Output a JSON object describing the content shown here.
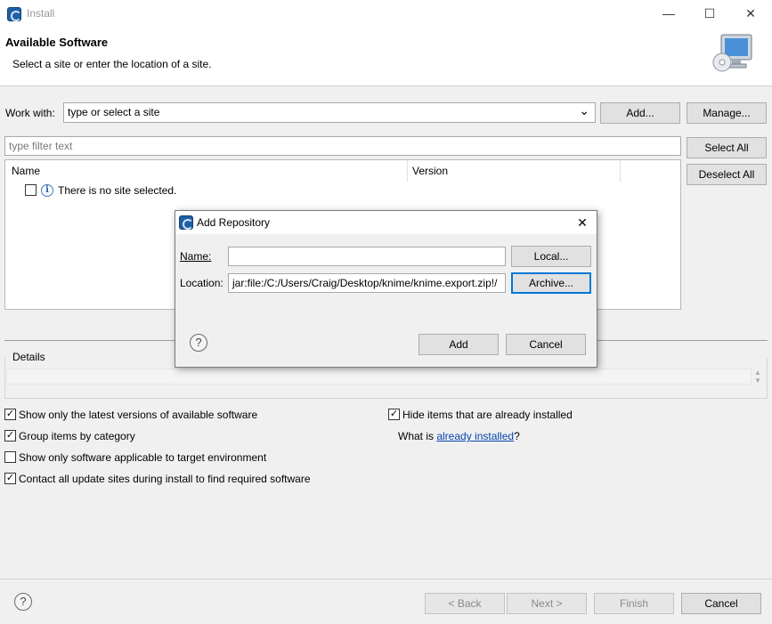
{
  "window": {
    "title": "Install",
    "minimize_glyph": "—",
    "maximize_glyph": "☐",
    "close_glyph": "✕"
  },
  "header": {
    "title": "Available Software",
    "subtitle": "Select a site or enter the location of a site."
  },
  "work_with": {
    "label": "Work with:",
    "placeholder": "type or select a site",
    "add_label": "Add...",
    "manage_label": "Manage..."
  },
  "filter": {
    "placeholder": "type filter text",
    "select_all_label": "Select All",
    "deselect_all_label": "Deselect All"
  },
  "table": {
    "columns": [
      "Name",
      "Version"
    ],
    "empty_message": "There is no site selected."
  },
  "details": {
    "label": "Details"
  },
  "options": {
    "show_latest": {
      "label": "Show only the latest versions of available software",
      "checked": true
    },
    "group_by_category": {
      "label": "Group items by category",
      "checked": true
    },
    "show_applicable": {
      "label": "Show only software applicable to target environment",
      "checked": false
    },
    "contact_all_sites": {
      "label": "Contact all update sites during install to find required software",
      "checked": true
    },
    "hide_installed": {
      "label": "Hide items that are already installed",
      "checked": true
    },
    "what_is_prefix": "What is ",
    "what_is_link": "already installed",
    "what_is_suffix": "?"
  },
  "footer": {
    "back_label": "< Back",
    "next_label": "Next >",
    "finish_label": "Finish",
    "cancel_label": "Cancel"
  },
  "dialog": {
    "title": "Add Repository",
    "name_label": "Name:",
    "name_value": "",
    "location_label": "Location:",
    "location_value": "jar:file:/C:/Users/Craig/Desktop/knime/knime.export.zip!/",
    "local_label": "Local...",
    "archive_label": "Archive...",
    "add_label": "Add",
    "cancel_label": "Cancel"
  },
  "icons": {
    "help": "?",
    "info": "i",
    "check": "✓",
    "dropdown": "⌄"
  },
  "colors": {
    "link": "#0645ad",
    "focus": "#0078d7",
    "app_icon": "#1f5fa8"
  }
}
